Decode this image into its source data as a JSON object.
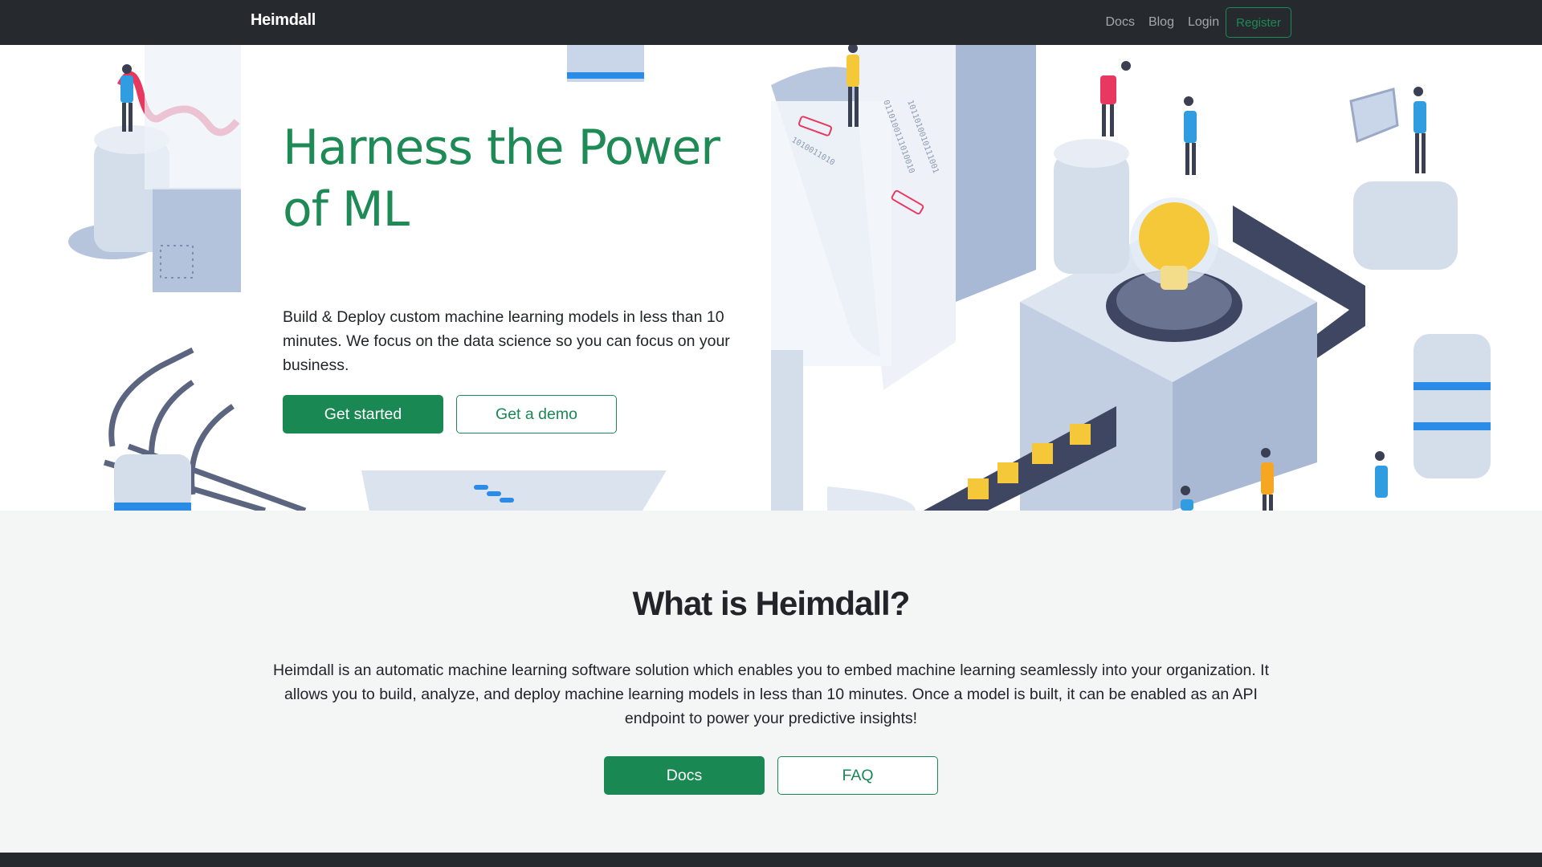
{
  "navbar": {
    "brand": "Heimdall",
    "links": [
      "Docs",
      "Blog",
      "Login"
    ],
    "register": "Register"
  },
  "hero": {
    "title": "Harness the Power of ML",
    "text": "Build & Deploy custom machine learning models in less than 10 minutes. We focus on the data science so you can focus on your business.",
    "primary_button": "Get started",
    "secondary_button": "Get a demo"
  },
  "about": {
    "title": "What is Heimdall?",
    "text": "Heimdall is an automatic machine learning software solution which enables you to embed machine learning seamlessly into your organization. It allows you to build, analyze, and deploy machine learning models in less than 10 minutes. Once a model is built, it can be enabled as an API endpoint to power your predictive insights!",
    "primary_button": "Docs",
    "secondary_button": "FAQ"
  },
  "colors": {
    "navbar": "#262a2f",
    "brand_green": "#1a8853",
    "page_bg": "#f4f5f5"
  }
}
